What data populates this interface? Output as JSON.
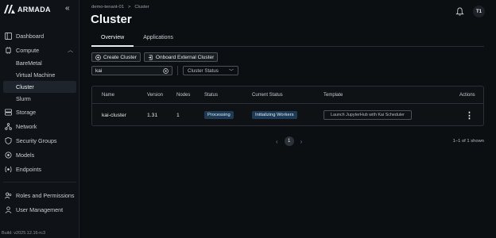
{
  "app": {
    "logo_text": "ARMADA",
    "build": "Build: v2025.12.16-rc3"
  },
  "sidebar": {
    "items": [
      {
        "label": "Dashboard",
        "icon": "dashboard-icon"
      },
      {
        "label": "Compute",
        "icon": "compute-icon",
        "expanded": true
      },
      {
        "label": "BareMetal"
      },
      {
        "label": "Virtual Machine"
      },
      {
        "label": "Cluster",
        "active": true
      },
      {
        "label": "Slurm"
      },
      {
        "label": "Storage",
        "icon": "storage-icon"
      },
      {
        "label": "Network",
        "icon": "network-icon"
      },
      {
        "label": "Security Groups",
        "icon": "shield-icon"
      },
      {
        "label": "Models",
        "icon": "models-icon"
      },
      {
        "label": "Endpoints",
        "icon": "endpoints-icon"
      },
      {
        "label": "Roles and Permissions",
        "icon": "roles-icon"
      },
      {
        "label": "User Management",
        "icon": "user-icon"
      }
    ]
  },
  "header": {
    "breadcrumb": [
      "demo-tenant-01",
      ">",
      "Cluster"
    ],
    "title": "Cluster",
    "avatar": "T1"
  },
  "tabs": [
    {
      "label": "Overview",
      "active": true
    },
    {
      "label": "Applications"
    }
  ],
  "toolbar": {
    "create_label": "Create Cluster",
    "onboard_label": "Onboard External Cluster"
  },
  "filters": {
    "search_value": "kai",
    "status_placeholder": "Cluster Status"
  },
  "table": {
    "columns": [
      "Name",
      "Version",
      "Nodes",
      "Status",
      "Current Status",
      "Template",
      "Actions"
    ],
    "rows": [
      {
        "name": "kai-cluster",
        "version": "1.31",
        "nodes": "1",
        "status": "Processing",
        "current_status": "Initializing Workers",
        "template": "Launch JupyterHub with Kai Scheduler",
        "actions": "⋮"
      }
    ]
  },
  "pagination": {
    "prev": "‹",
    "page": "1",
    "next": "›",
    "count": "1–1 of 1 shown"
  }
}
